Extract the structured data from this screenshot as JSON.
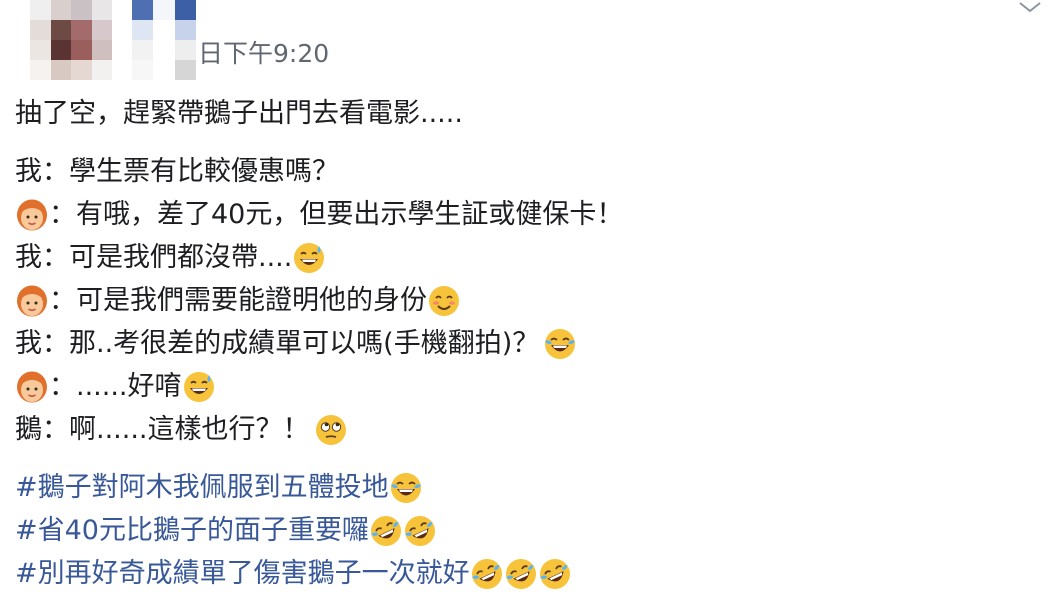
{
  "post": {
    "timestamp": "日下午9:20",
    "intro": "抽了空，趕緊帶鵝子出門去看電影.....",
    "dialogue": [
      {
        "speaker": "我",
        "text": "：學生票有比較優惠嗎？",
        "emoji_after": []
      },
      {
        "speaker_icon": "woman-icon",
        "text": "：有哦，差了40元，但要出示學生証或健保卡！",
        "emoji_after": []
      },
      {
        "speaker": "我",
        "text": "：可是我們都沒帶....",
        "emoji_after": [
          "grinning-sweat-icon"
        ]
      },
      {
        "speaker_icon": "woman-icon",
        "text": "：可是我們需要能證明他的身份",
        "emoji_after": [
          "smiling-blush-icon"
        ]
      },
      {
        "speaker": "我",
        "text": "：那..考很差的成績單可以嗎(手機翻拍)？",
        "emoji_after": [
          "tears-of-joy-icon"
        ]
      },
      {
        "speaker_icon": "woman-icon",
        "text": "：......好唷",
        "emoji_after": [
          "grinning-sweat-icon"
        ]
      },
      {
        "speaker": "鵝",
        "text": "：啊......這樣也行？！",
        "emoji_after": [
          "rolling-eyes-icon"
        ]
      }
    ],
    "hashtags": [
      {
        "text": "#鵝子對阿木我佩服到五體投地",
        "emoji_after": [
          "tears-of-joy-icon"
        ]
      },
      {
        "text": "#省40元比鵝子的面子重要囉",
        "emoji_after": [
          "rolling-laughing-icon",
          "rolling-laughing-icon"
        ]
      },
      {
        "text": "#別再好奇成績單了傷害鵝子一次就好",
        "emoji_after": [
          "rolling-laughing-icon",
          "rolling-laughing-icon",
          "rolling-laughing-icon"
        ]
      }
    ]
  },
  "colors": {
    "text": "#1c1e21",
    "timestamp": "#616770",
    "hashtag": "#385898",
    "emoji_yellow": "#f7c33a"
  }
}
